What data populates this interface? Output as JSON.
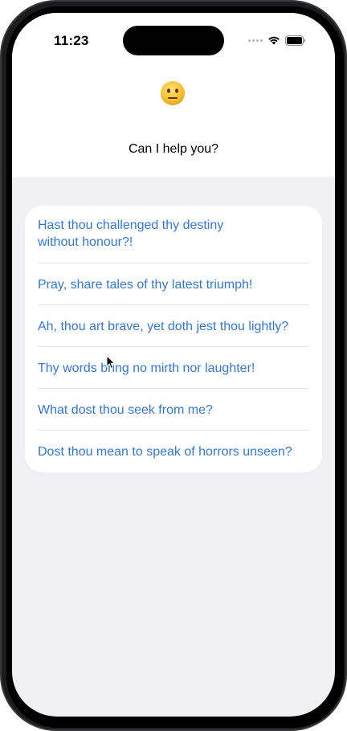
{
  "status_bar": {
    "time": "11:23"
  },
  "header": {
    "emoji_icon": "neutral-face-emoji",
    "title": "Can I help you?"
  },
  "options": [
    {
      "label": "Hast thou challenged thy destiny without honour?!"
    },
    {
      "label": "Pray, share tales of thy latest triumph!"
    },
    {
      "label": "Ah, thou art brave, yet doth jest thou lightly?"
    },
    {
      "label": "Thy words bring no mirth nor laughter!"
    },
    {
      "label": "What dost thou seek from me?"
    },
    {
      "label": "Dost thou mean to speak of horrors unseen?"
    }
  ],
  "colors": {
    "accent": "#3478d4",
    "background": "#efeff4",
    "card": "#ffffff"
  }
}
